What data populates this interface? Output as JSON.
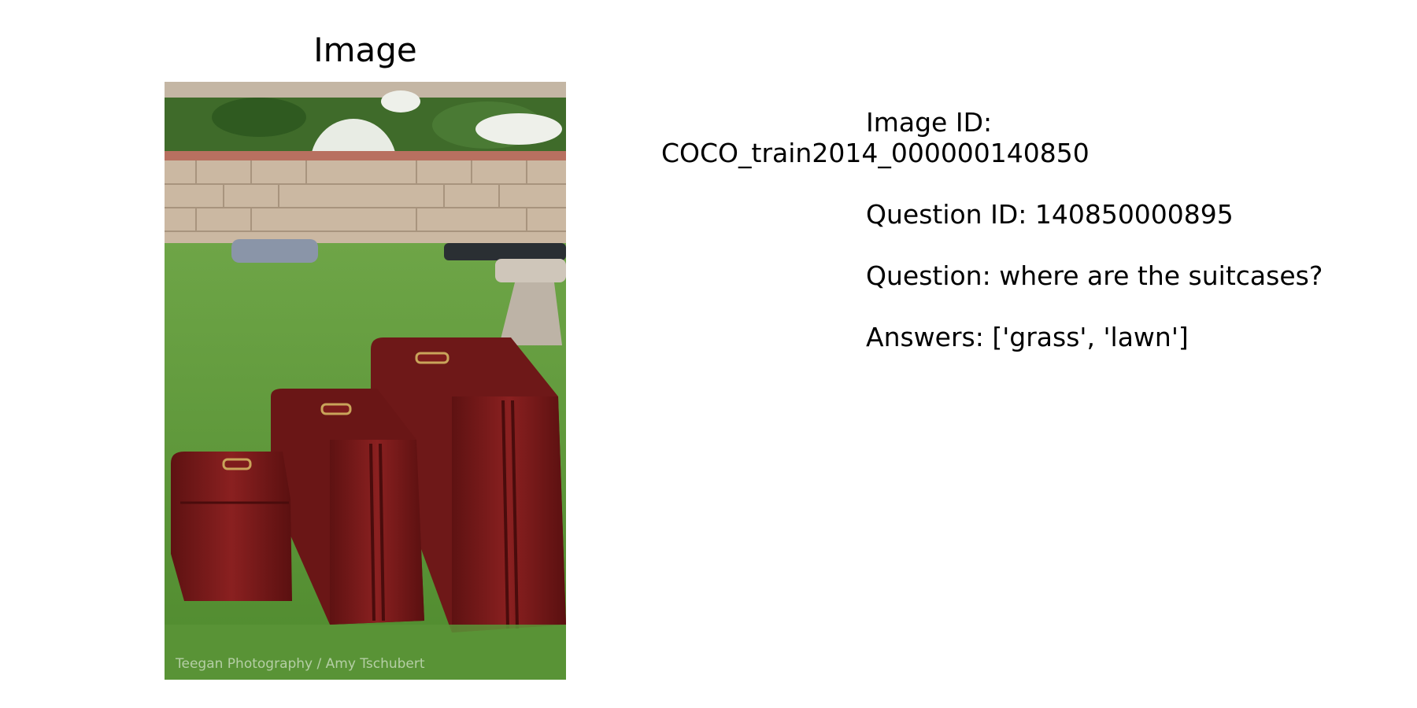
{
  "panel": {
    "title": "Image"
  },
  "photo": {
    "description_icon": "photo-suitcases-on-grass",
    "watermark": "Teegan Photography / Amy Tschubert",
    "colors": {
      "grass": "#5f9a3a",
      "wall": "#c7b39e",
      "suitcase": "#7a1a1a",
      "hardware": "#c9a45a"
    }
  },
  "info": {
    "image_id_label": "Image ID:",
    "image_id_value": "COCO_train2014_000000140850",
    "question_id": "Question ID: 140850000895",
    "question": "Question: where are the suitcases?",
    "answers": "Answers: ['grass', 'lawn']"
  }
}
